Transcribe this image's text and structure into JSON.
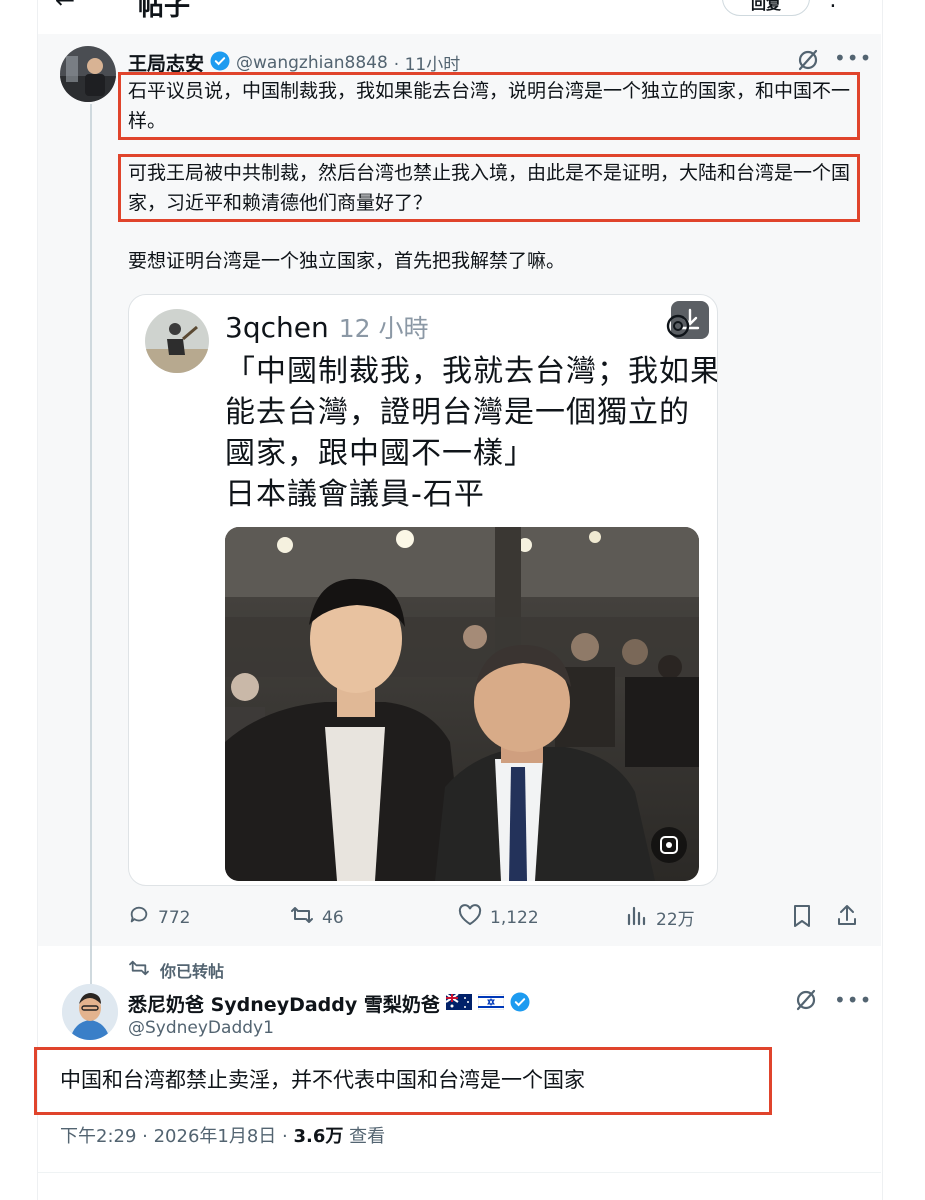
{
  "top_bar": {
    "title": "帖子",
    "pill_label": "回复"
  },
  "quoted_tweet": {
    "author_name": "王局志安",
    "handle": "@wangzhian8848",
    "time": "· 11小时",
    "paragraph_1": "石平议员说，中国制裁我，我如果能去台湾，说明台湾是一个独立的国家，和中国不一样。",
    "paragraph_2": "可我王局被中共制裁，然后台湾也禁止我入境，由此是不是证明，大陆和台湾是一个国家，习近平和赖清德他们商量好了？",
    "paragraph_3": "要想证明台湾是一个独立国家，首先把我解禁了嘛。",
    "embedded_post": {
      "author": "3qchen",
      "time": "12 小時",
      "line_1": "「中國制裁我，我就去台灣；我如果",
      "line_2": "能去台灣，證明台灣是一個獨立的",
      "line_3": "國家，跟中國不一樣」",
      "line_4": "日本議會議員-石平"
    },
    "stats": {
      "replies": "772",
      "reposts": "46",
      "likes": "1,122",
      "views": "22万"
    }
  },
  "retweet_banner": "你已转帖",
  "main_tweet": {
    "author_name": "悉尼奶爸 SydneyDaddy 雪梨奶爸",
    "handle": "@SydneyDaddy1",
    "text": "中国和台湾都禁止卖淫，并不代表中国和台湾是一个国家",
    "timestamp": "下午2:29 · 2026年1月8日 · ",
    "views_count": "3.6万",
    "views_label": " 查看"
  },
  "icons": [
    "back-arrow-icon",
    "more-icon",
    "verified-badge-icon",
    "grok-icon",
    "download-icon",
    "reply-icon",
    "repost-icon",
    "like-icon",
    "views-icon",
    "bookmark-icon",
    "share-icon",
    "image-edit-icon",
    "australia-flag-icon",
    "israel-flag-icon"
  ],
  "colors": {
    "accent": "#1d9bf0",
    "highlight_box": "#e0442c",
    "secondary_text": "#536471"
  }
}
